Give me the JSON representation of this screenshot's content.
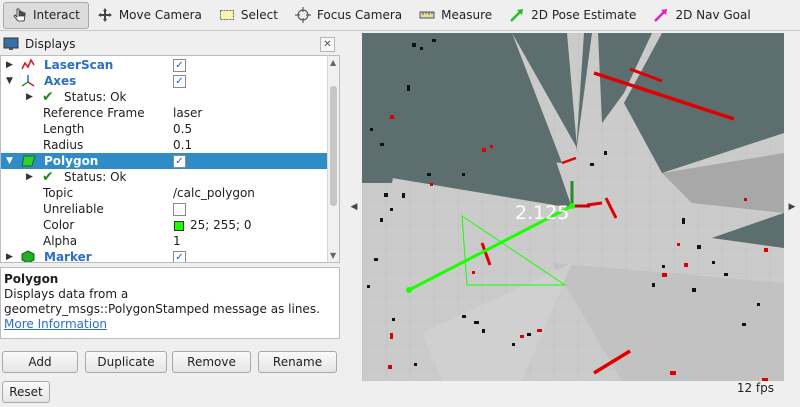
{
  "toolbar": {
    "interact": "Interact",
    "move_camera": "Move Camera",
    "select": "Select",
    "focus_camera": "Focus Camera",
    "measure": "Measure",
    "pose_estimate": "2D Pose Estimate",
    "nav_goal": "2D Nav Goal"
  },
  "panel": {
    "title": "Displays"
  },
  "tree": {
    "laserscan": "LaserScan",
    "axes": "Axes",
    "axes_status": "Status: Ok",
    "ref_frame_label": "Reference Frame",
    "ref_frame_value": "laser",
    "length_label": "Length",
    "length_value": "0.5",
    "radius_label": "Radius",
    "radius_value": "0.1",
    "polygon": "Polygon",
    "polygon_status": "Status: Ok",
    "topic_label": "Topic",
    "topic_value": "/calc_polygon",
    "unreliable_label": "Unreliable",
    "color_label": "Color",
    "color_value": "25; 255; 0",
    "alpha_label": "Alpha",
    "alpha_value": "1",
    "marker": "Marker"
  },
  "description": {
    "title": "Polygon",
    "text": "Displays data from a geometry_msgs::PolygonStamped message as lines.",
    "link": "More Information"
  },
  "buttons": {
    "add": "Add",
    "duplicate": "Duplicate",
    "remove": "Remove",
    "rename": "Rename",
    "reset": "Reset"
  },
  "viewport": {
    "measure_label": "2.125",
    "fps": "12 fps"
  },
  "colors": {
    "selection": "#308cc6",
    "polygon_color": "#19ff00",
    "scan": "#e00000"
  }
}
